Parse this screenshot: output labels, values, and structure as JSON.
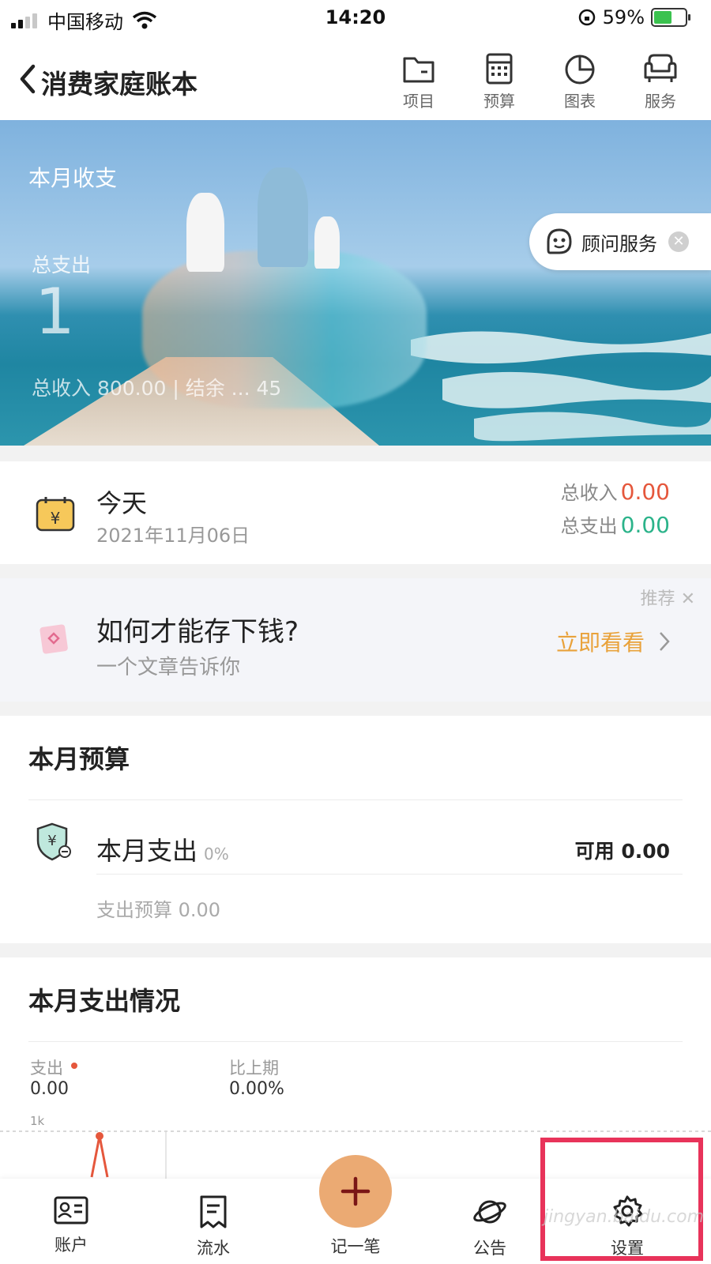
{
  "status_bar": {
    "carrier": "中国移动",
    "time": "14:20",
    "battery": "59%"
  },
  "header": {
    "title": "消费家庭账本",
    "actions": [
      {
        "label": "项目",
        "icon": "folder-icon"
      },
      {
        "label": "预算",
        "icon": "calculator-icon"
      },
      {
        "label": "图表",
        "icon": "pie-chart-icon"
      },
      {
        "label": "服务",
        "icon": "sofa-icon"
      }
    ]
  },
  "banner": {
    "section_label": "本月收支",
    "total_expense_label": "总支出",
    "total_expense_value": "1",
    "bottom_line": "总收入 800.00 | 结余 ... 45",
    "advisor_label": "顾问服务"
  },
  "today": {
    "title": "今天",
    "date": "2021年11月06日",
    "income_label": "总收入",
    "income_value": "0.00",
    "expense_label": "总支出",
    "expense_value": "0.00"
  },
  "recommend": {
    "tag": "推荐",
    "title": "如何才能存下钱?",
    "subtitle": "一个文章告诉你",
    "cta": "立即看看"
  },
  "budget": {
    "section_title": "本月预算",
    "name": "本月支出",
    "percent": "0%",
    "available": "可用 0.00",
    "sub": "支出预算 0.00"
  },
  "spending": {
    "section_title": "本月支出情况",
    "expense_label": "支出",
    "expense_value": "0.00",
    "compare_label": "比上期",
    "compare_value": "0.00%",
    "axis_tick": "1k"
  },
  "bottom_nav": {
    "items": [
      {
        "label": "账户",
        "icon": "account-card-icon"
      },
      {
        "label": "流水",
        "icon": "list-icon"
      },
      {
        "label": "记一笔",
        "icon": "plus-icon"
      },
      {
        "label": "公告",
        "icon": "planet-icon"
      },
      {
        "label": "设置",
        "icon": "gear-icon"
      }
    ]
  },
  "watermark": "jingyan.baidu.com",
  "colors": {
    "income": "#e5573c",
    "expense": "#2bb38a",
    "accent": "#e9a23b",
    "fab": "#ebaa73",
    "highlight": "#e8335a"
  }
}
